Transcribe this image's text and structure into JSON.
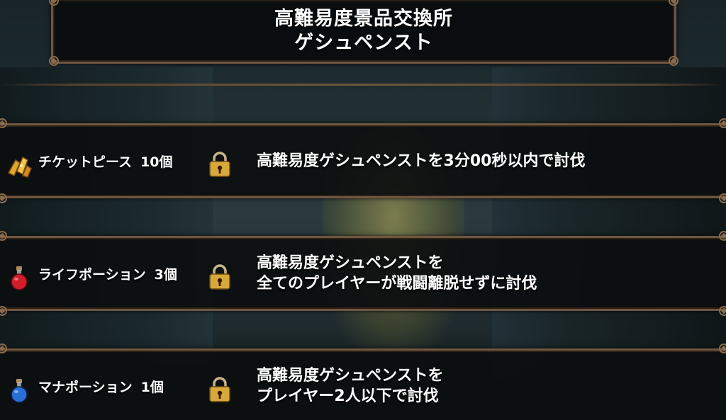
{
  "header": {
    "title_line1": "高難易度景品交換所",
    "title_line2": "ゲシュペンスト"
  },
  "rewards": [
    {
      "item_name": "チケットピース",
      "quantity": "10個",
      "item_icon": "ticket-pieces-icon",
      "locked": true,
      "condition_lines": [
        "高難易度ゲシュペンストを3分00秒以内で討伐"
      ]
    },
    {
      "item_name": "ライフポーション",
      "quantity": "3個",
      "item_icon": "life-potion-icon",
      "locked": true,
      "condition_lines": [
        "高難易度ゲシュペンストを",
        "全てのプレイヤーが戦闘離脱せずに討伐"
      ]
    },
    {
      "item_name": "マナポーション",
      "quantity": "1個",
      "item_icon": "mana-potion-icon",
      "locked": true,
      "condition_lines": [
        "高難易度ゲシュペンストを",
        "プレイヤー2人以下で討伐"
      ]
    }
  ],
  "colors": {
    "frame": "#6e5640",
    "panel": "#0c0e0f",
    "life_potion": "#d21e2a",
    "mana_potion": "#2a6fd6",
    "lock_gold": "#d8a93a"
  }
}
